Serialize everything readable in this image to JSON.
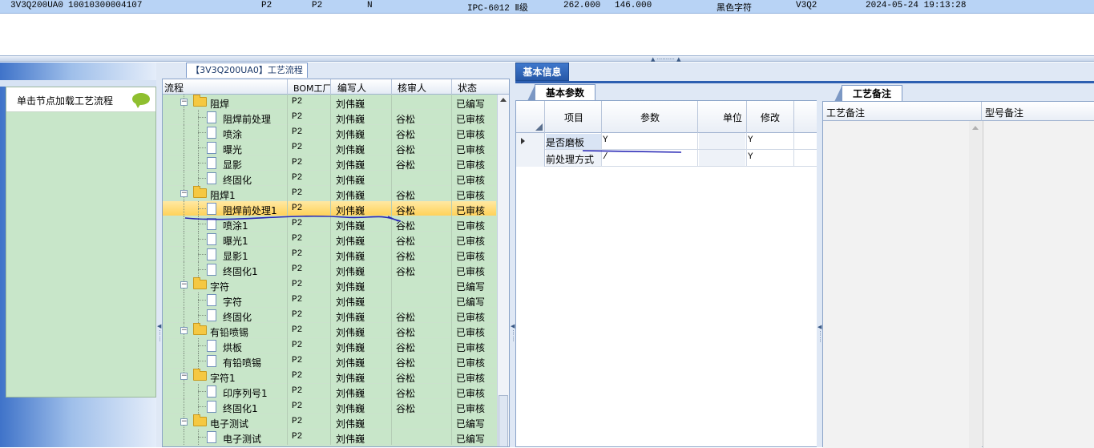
{
  "top_record": {
    "code": "3V3Q200UA0",
    "serial": "10010300004107",
    "f1": "P2",
    "f2": "P2",
    "f3": "N",
    "grade": "IPC-6012 Ⅱ级",
    "v1": "262.000",
    "v2": "146.000",
    "char_color": "黑色字符",
    "rev": "V3Q2",
    "timestamp": "2024-05-24 19:13:28"
  },
  "left_panel": {
    "load_label": "单击节点加载工艺流程",
    "bubble_icon": "speech-bubble-icon"
  },
  "tree_panel": {
    "title": "【3V3Q200UA0】工艺流程",
    "headers": {
      "flow": "流程",
      "bom": "BOM工厂",
      "writer": "编写人",
      "reviewer": "核审人",
      "status": "状态"
    },
    "rows": [
      {
        "level": 0,
        "name": "阻焊",
        "bom": "P2",
        "writer": "刘伟巍",
        "reviewer": "",
        "status": "已编写"
      },
      {
        "level": 1,
        "name": "阻焊前处理",
        "bom": "P2",
        "writer": "刘伟巍",
        "reviewer": "谷松",
        "status": "已审核"
      },
      {
        "level": 1,
        "name": "喷涂",
        "bom": "P2",
        "writer": "刘伟巍",
        "reviewer": "谷松",
        "status": "已审核"
      },
      {
        "level": 1,
        "name": "曝光",
        "bom": "P2",
        "writer": "刘伟巍",
        "reviewer": "谷松",
        "status": "已审核"
      },
      {
        "level": 1,
        "name": "显影",
        "bom": "P2",
        "writer": "刘伟巍",
        "reviewer": "谷松",
        "status": "已审核"
      },
      {
        "level": 1,
        "name": "终固化",
        "bom": "P2",
        "writer": "刘伟巍",
        "reviewer": "",
        "status": "已审核"
      },
      {
        "level": 0,
        "name": "阻焊1",
        "bom": "P2",
        "writer": "刘伟巍",
        "reviewer": "谷松",
        "status": "已审核"
      },
      {
        "level": 1,
        "name": "阻焊前处理1",
        "bom": "P2",
        "writer": "刘伟巍",
        "reviewer": "谷松",
        "status": "已审核",
        "selected": true
      },
      {
        "level": 1,
        "name": "喷涂1",
        "bom": "P2",
        "writer": "刘伟巍",
        "reviewer": "谷松",
        "status": "已审核"
      },
      {
        "level": 1,
        "name": "曝光1",
        "bom": "P2",
        "writer": "刘伟巍",
        "reviewer": "谷松",
        "status": "已审核"
      },
      {
        "level": 1,
        "name": "显影1",
        "bom": "P2",
        "writer": "刘伟巍",
        "reviewer": "谷松",
        "status": "已审核"
      },
      {
        "level": 1,
        "name": "终固化1",
        "bom": "P2",
        "writer": "刘伟巍",
        "reviewer": "谷松",
        "status": "已审核"
      },
      {
        "level": 0,
        "name": "字符",
        "bom": "P2",
        "writer": "刘伟巍",
        "reviewer": "",
        "status": "已编写"
      },
      {
        "level": 1,
        "name": "字符",
        "bom": "P2",
        "writer": "刘伟巍",
        "reviewer": "",
        "status": "已编写"
      },
      {
        "level": 1,
        "name": "终固化",
        "bom": "P2",
        "writer": "刘伟巍",
        "reviewer": "谷松",
        "status": "已审核"
      },
      {
        "level": 0,
        "name": "有铅喷锡",
        "bom": "P2",
        "writer": "刘伟巍",
        "reviewer": "谷松",
        "status": "已审核"
      },
      {
        "level": 1,
        "name": "烘板",
        "bom": "P2",
        "writer": "刘伟巍",
        "reviewer": "谷松",
        "status": "已审核"
      },
      {
        "level": 1,
        "name": "有铅喷锡",
        "bom": "P2",
        "writer": "刘伟巍",
        "reviewer": "谷松",
        "status": "已审核"
      },
      {
        "level": 0,
        "name": "字符1",
        "bom": "P2",
        "writer": "刘伟巍",
        "reviewer": "谷松",
        "status": "已审核"
      },
      {
        "level": 1,
        "name": "印序列号1",
        "bom": "P2",
        "writer": "刘伟巍",
        "reviewer": "谷松",
        "status": "已审核"
      },
      {
        "level": 1,
        "name": "终固化1",
        "bom": "P2",
        "writer": "刘伟巍",
        "reviewer": "谷松",
        "status": "已审核"
      },
      {
        "level": 0,
        "name": "电子测试",
        "bom": "P2",
        "writer": "刘伟巍",
        "reviewer": "",
        "status": "已编写"
      },
      {
        "level": 1,
        "name": "电子测试",
        "bom": "P2",
        "writer": "刘伟巍",
        "reviewer": "",
        "status": "已编写"
      }
    ]
  },
  "info_panel": {
    "tab": "基本信息",
    "subtab": "基本参数",
    "headers": {
      "item": "项目",
      "param": "参数",
      "unit": "单位",
      "modify": "修改"
    },
    "rows": [
      {
        "item": "是否磨板",
        "param": "Y",
        "unit": "",
        "modify": "Y"
      },
      {
        "item": "前处理方式",
        "param": "/",
        "unit": "",
        "modify": "Y"
      }
    ]
  },
  "note_panel": {
    "tab": "工艺备注",
    "col1": "工艺备注",
    "col2": "型号备注"
  }
}
